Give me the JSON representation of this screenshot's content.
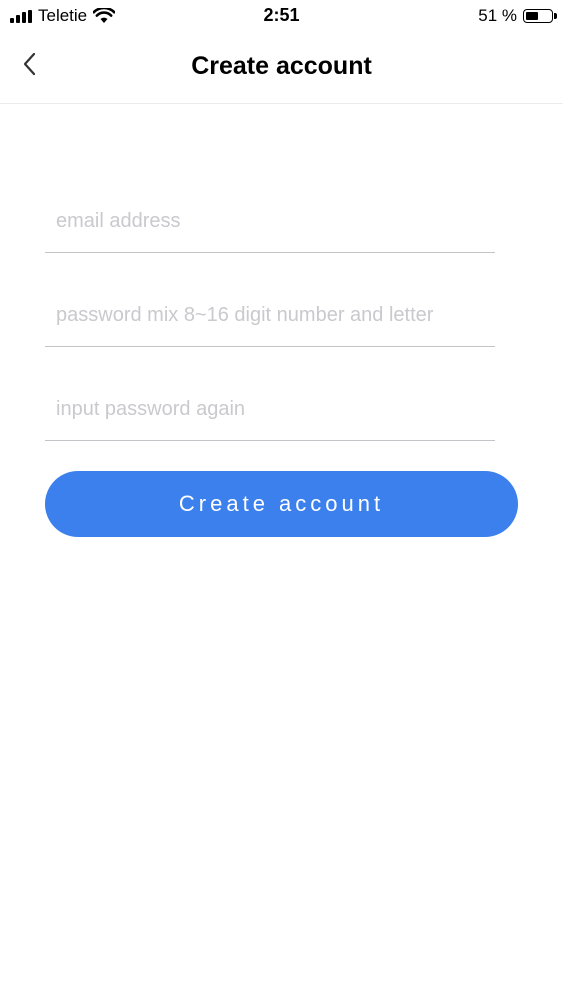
{
  "status_bar": {
    "carrier": "Teletie",
    "time": "2:51",
    "battery_percent_label": "51 %",
    "battery_level": 0.51,
    "icons": [
      "signal-icon",
      "wifi-icon",
      "battery-icon"
    ]
  },
  "nav": {
    "title": "Create account",
    "back_icon": "chevron-left-icon"
  },
  "form": {
    "email": {
      "placeholder": "email address",
      "value": ""
    },
    "password": {
      "placeholder": "password mix 8~16 digit number and letter",
      "value": ""
    },
    "password_confirm": {
      "placeholder": "input password again",
      "value": ""
    },
    "submit_label": "Create account"
  },
  "colors": {
    "accent": "#3b80ec",
    "field_underline": "#c4c4c8",
    "placeholder": "#c9c9ce",
    "background": "#ffffff"
  }
}
